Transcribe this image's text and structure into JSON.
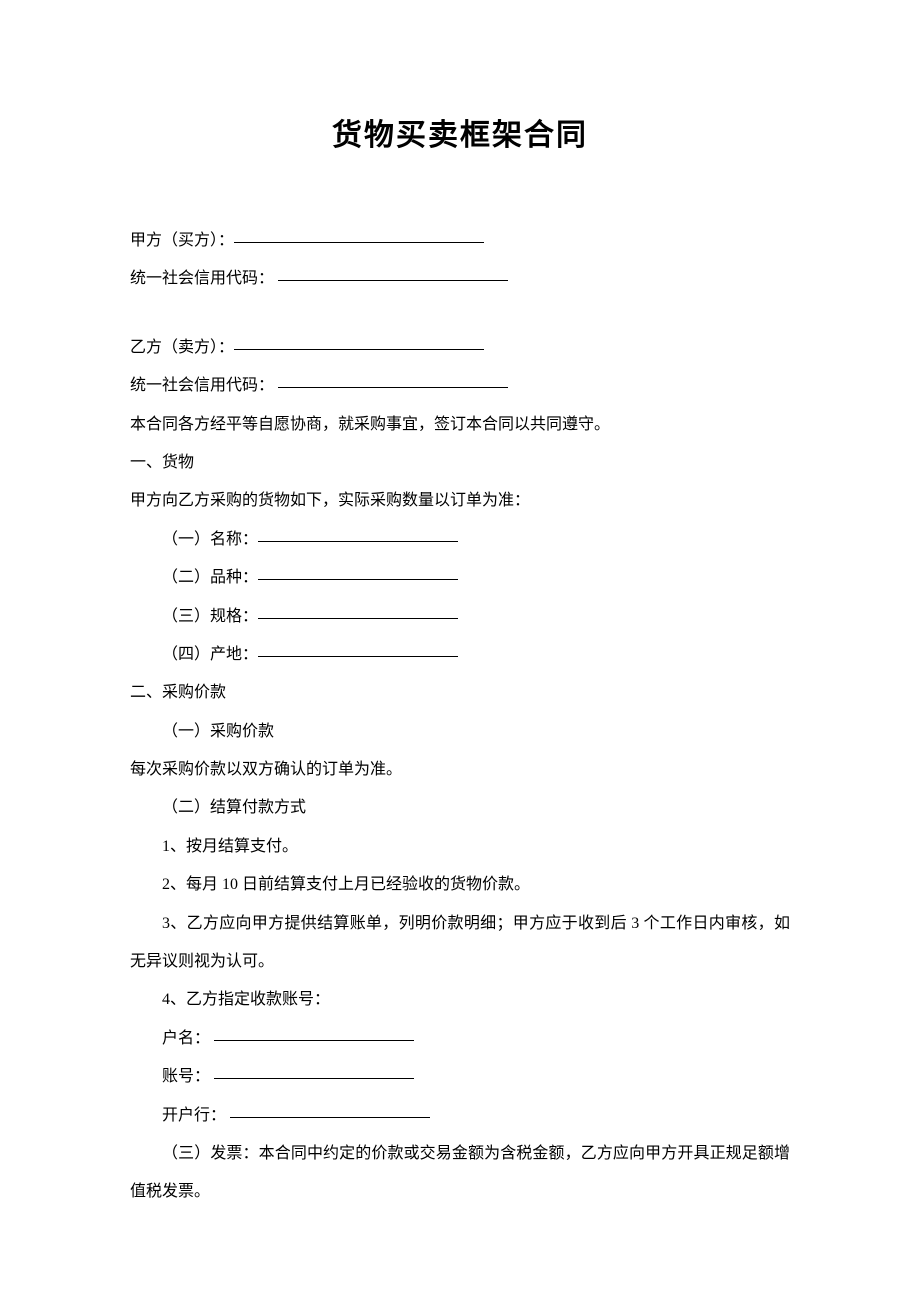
{
  "title": "货物买卖框架合同",
  "partyA": {
    "label": "甲方（买方）：",
    "creditLabel": "统一社会信用代码："
  },
  "partyB": {
    "label": "乙方（卖方）：",
    "creditLabel": "统一社会信用代码："
  },
  "preamble": "本合同各方经平等自愿协商，就采购事宜，签订本合同以共同遵守。",
  "section1": {
    "heading": "一、货物",
    "intro": "甲方向乙方采购的货物如下，实际采购数量以订单为准：",
    "item1": "（一）名称：",
    "item2": "（二）品种：",
    "item3": "（三）规格：",
    "item4": "（四）产地："
  },
  "section2": {
    "heading": "二、采购价款",
    "sub1": "（一）采购价款",
    "sub1text": "每次采购价款以双方确认的订单为准。",
    "sub2": "（二）结算付款方式",
    "p1": "1、按月结算支付。",
    "p2": "2、每月 10 日前结算支付上月已经验收的货物价款。",
    "p3": "3、乙方应向甲方提供结算账单，列明价款明细；甲方应于收到后 3 个工作日内审核，如无异议则视为认可。",
    "p4": "4、乙方指定收款账号：",
    "acct_name": "户名：",
    "acct_no": "账号：",
    "acct_bank": "开户行：",
    "sub3": "（三）发票：本合同中约定的价款或交易金额为含税金额，乙方应向甲方开具正规足额增值税发票。"
  }
}
